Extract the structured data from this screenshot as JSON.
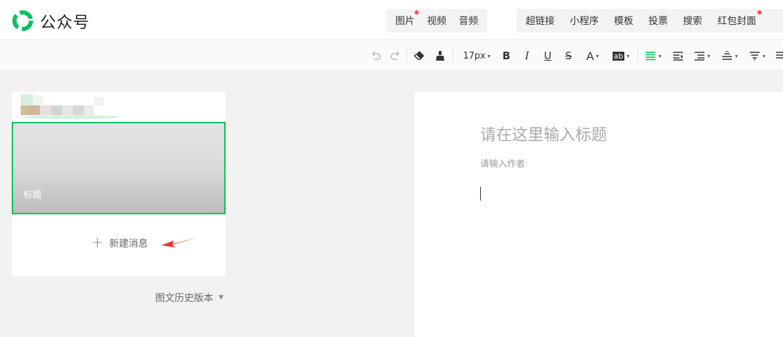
{
  "app": {
    "name": "公众号"
  },
  "insert_toolbar": {
    "media": [
      {
        "label": "图片",
        "dot": true
      },
      {
        "label": "视频",
        "dot": false
      },
      {
        "label": "音频",
        "dot": false
      }
    ],
    "tools": [
      {
        "label": "超链接",
        "dot": false
      },
      {
        "label": "小程序",
        "dot": false
      },
      {
        "label": "模板",
        "dot": false
      },
      {
        "label": "投票",
        "dot": false
      },
      {
        "label": "搜索",
        "dot": false
      },
      {
        "label": "红包封面",
        "dot": true
      }
    ]
  },
  "format_toolbar": {
    "font_size": "17px",
    "font_color_label": "A",
    "highlight_label": "ab",
    "bold": "B",
    "italic": "I",
    "underline": "U",
    "strike": "S",
    "active_color": "#07c160"
  },
  "message_list": {
    "cover_title": "标题",
    "new_message": "新建消息",
    "history": "图文历史版本"
  },
  "editor": {
    "title_placeholder": "请在这里输入标题",
    "author_placeholder": "请输入作者"
  },
  "colors": {
    "brand": "#07c160",
    "dot": "#fa5151",
    "arrow": "#e53935"
  }
}
